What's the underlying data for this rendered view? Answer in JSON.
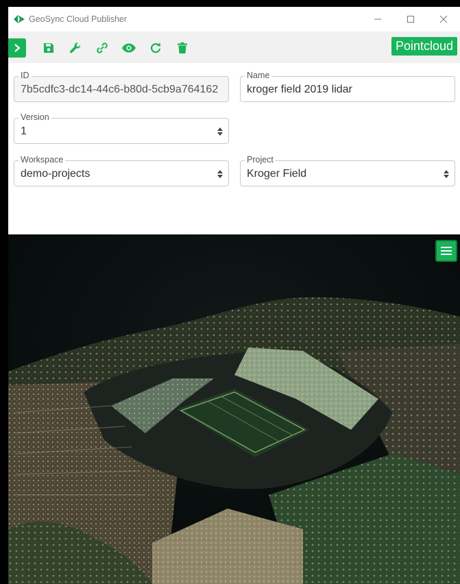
{
  "window": {
    "title": "GeoSync Cloud Publisher",
    "controls": [
      "minimize",
      "maximize",
      "close"
    ]
  },
  "toolbar": {
    "icons": [
      "chevron-right-icon",
      "save-icon",
      "wrench-icon",
      "link-icon",
      "eye-icon",
      "refresh-icon",
      "trash-icon"
    ],
    "type_label": "Pointcloud"
  },
  "form": {
    "id": {
      "label": "ID",
      "value": "7b5cdfc3-dc14-44c6-b80d-5cb9a764162"
    },
    "name": {
      "label": "Name",
      "value": "kroger field 2019 lidar"
    },
    "version": {
      "label": "Version",
      "value": "1"
    },
    "workspace": {
      "label": "Workspace",
      "value": "demo-projects"
    },
    "project": {
      "label": "Project",
      "value": "Kroger Field"
    }
  },
  "viewer": {
    "menu_icon": "hamburger-menu-icon"
  },
  "colors": {
    "accent": "#1ab35a",
    "viewer_bg": "#0b1010"
  }
}
